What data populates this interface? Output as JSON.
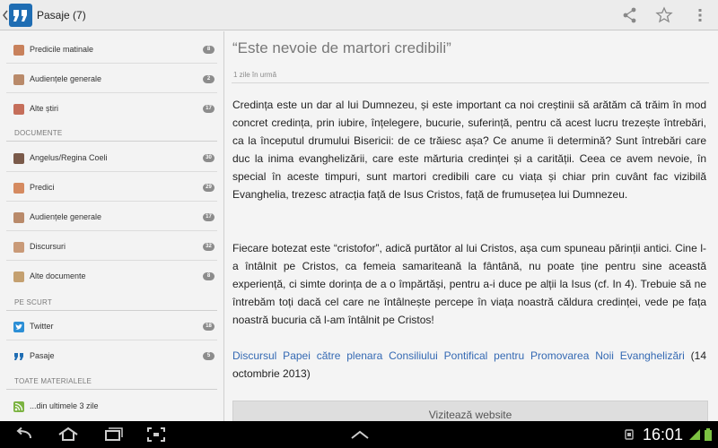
{
  "actionbar": {
    "title": "Pasaje (7)",
    "logo_icon": "quote-icon",
    "actions": [
      "share-icon",
      "star-icon",
      "more-vert-icon"
    ]
  },
  "sidebar": {
    "top_items": [
      {
        "label": "Predicile matinale",
        "badge": "8",
        "icon": "pope-avatar-icon"
      },
      {
        "label": "Audiențele generale",
        "badge": "2",
        "icon": "pope-avatar-icon"
      },
      {
        "label": "Alte știri",
        "badge": "17",
        "icon": "pope-avatar-icon"
      }
    ],
    "documente": {
      "header": "DOCUMENTE",
      "items": [
        {
          "label": "Angelus/Regina Coeli",
          "badge": "30",
          "icon": "pope-avatar-icon"
        },
        {
          "label": "Predici",
          "badge": "29",
          "icon": "pope-avatar-icon"
        },
        {
          "label": "Audiențele generale",
          "badge": "17",
          "icon": "pope-avatar-icon"
        },
        {
          "label": "Discursuri",
          "badge": "32",
          "icon": "pope-avatar-icon"
        },
        {
          "label": "Alte documente",
          "badge": "8",
          "icon": "pope-avatar-icon"
        }
      ]
    },
    "pe_scurt": {
      "header": "PE SCURT",
      "items": [
        {
          "label": "Twitter",
          "badge": "18",
          "icon": "twitter-icon"
        },
        {
          "label": "Pasaje",
          "badge": "5",
          "icon": "quote-icon"
        }
      ]
    },
    "toate": {
      "header": "TOATE MATERIALELE",
      "items": [
        {
          "label": "...din ultimele 3 zile",
          "badge": "",
          "icon": "rss-icon"
        }
      ]
    }
  },
  "article": {
    "title": "“Este nevoie de martori credibili”",
    "date": "1 zile în urmă",
    "paragraph1": "Credința este un dar al lui Dumnezeu, și este important ca noi creștinii să arătăm că trăim în mod concret credința, prin iubire, înțelegere, bucurie, suferință, pentru că acest lucru trezește întrebări, ca la începutul drumului Bisericii: de ce trăiesc așa? Ce anume îi determină? Sunt întrebări care duc la inima evanghelizării, care este mărturia credinței și a carității. Ceea ce avem nevoie, în special în aceste timpuri, sunt martori credibili care cu viața și chiar prin cuvânt fac vizibilă Evanghelia, trezesc atracția față de Isus Cristos, față de frumusețea lui Dumnezeu.",
    "paragraph2": "Fiecare botezat este “cristofor”, adică purtător al lui Cristos, așa cum spuneau părinții antici. Cine l-a întâlnit pe Cristos, ca femeia samariteană la fântână, nu poate ține pentru sine această experiență, ci simte dorința de a o împărtăși, pentru a-i duce pe alții la Isus (cf. In 4). Trebuie să ne întrebăm toți dacă cel care ne întâlnește percepe în viața noastră căldura credinței, vede pe fața noastră bucuria că l-am întâlnit pe Cristos!",
    "source_link": "Discursul Papei către plenara Consiliului Pontifical pentru Promovarea Noii Evanghelizări",
    "source_suffix": " (14 octombrie 2013)",
    "visit_button": "Vizitează website"
  },
  "system_bar": {
    "time": "16:01",
    "nav_icons": [
      "back-icon",
      "home-icon",
      "recent-apps-icon",
      "screenshot-icon",
      "up-chevron-icon"
    ],
    "status_icons": [
      "usb-icon",
      "signal-icon",
      "battery-icon"
    ]
  },
  "colors": {
    "accent_blue": "#1f6db3",
    "link_blue": "#3469b3",
    "badge_gray": "#8c8c8c"
  }
}
